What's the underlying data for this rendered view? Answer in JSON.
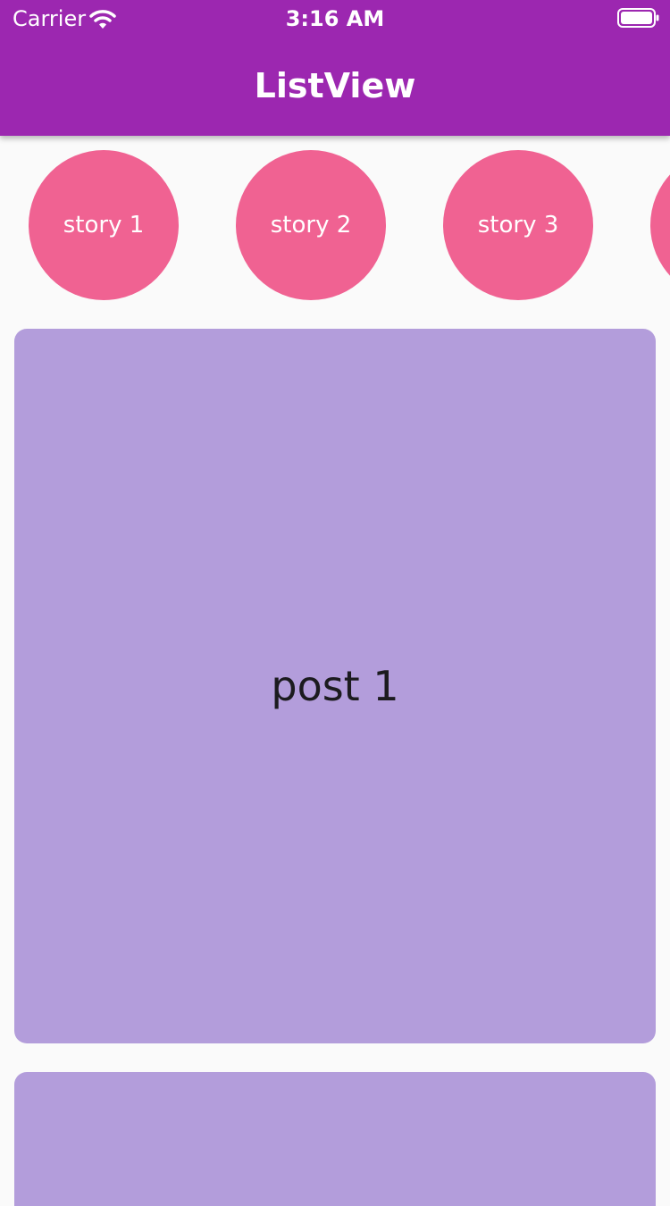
{
  "status_bar": {
    "carrier": "Carrier",
    "time": "3:16 AM",
    "icons": [
      "wifi-icon",
      "battery-icon"
    ]
  },
  "app_bar": {
    "title": "ListView",
    "color": "#9c27b0"
  },
  "stories": {
    "color": "#f06292",
    "items": [
      {
        "label": "story 1"
      },
      {
        "label": "story 2"
      },
      {
        "label": "story 3"
      },
      {
        "label": ""
      }
    ]
  },
  "posts": {
    "color": "#b39ddb",
    "items": [
      {
        "label": "post 1"
      },
      {
        "label": ""
      }
    ]
  }
}
